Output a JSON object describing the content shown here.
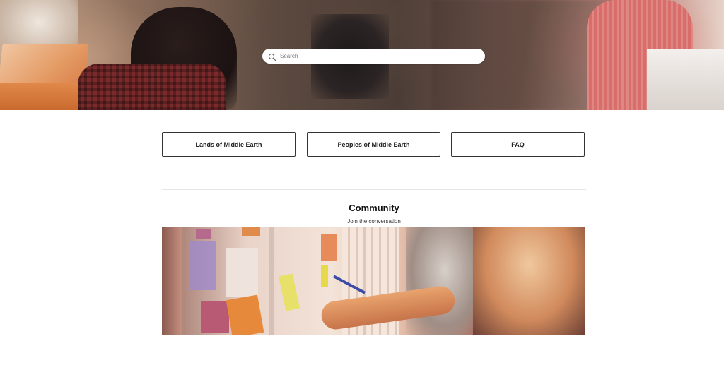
{
  "search": {
    "placeholder": "Search"
  },
  "tiles": [
    {
      "label": "Lands of Middle Earth"
    },
    {
      "label": "Peoples of Middle Earth"
    },
    {
      "label": "FAQ"
    }
  ],
  "community": {
    "title": "Community",
    "subtitle": "Join the conversation"
  },
  "icons": {
    "search": "search-icon"
  },
  "colors": {
    "tile_border": "#333333",
    "background": "#ffffff"
  }
}
